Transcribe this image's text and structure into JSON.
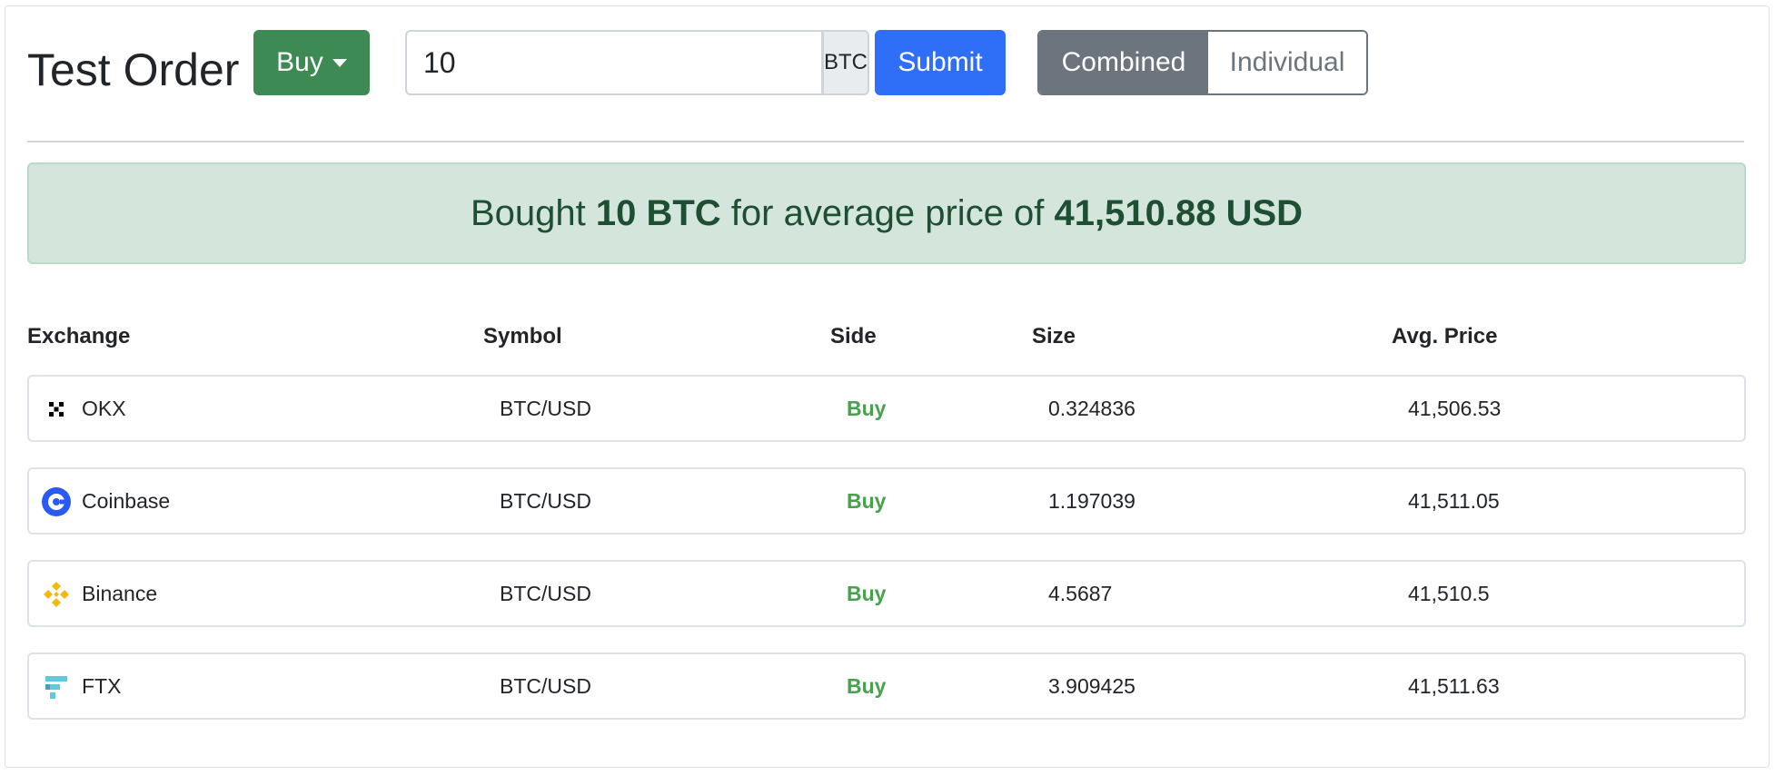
{
  "header": {
    "title": "Test Order",
    "side_dropdown_label": "Buy",
    "quantity_value": "10",
    "quantity_unit": "BTC",
    "submit_label": "Submit",
    "view_toggle": {
      "combined_label": "Combined",
      "individual_label": "Individual",
      "selected": "Combined"
    }
  },
  "result": {
    "prefix": "Bought",
    "amount": "10 BTC",
    "middle": "for average price of",
    "avg_price": "41,510.88 USD"
  },
  "table": {
    "columns": [
      "Exchange",
      "Symbol",
      "Side",
      "Size",
      "Avg. Price"
    ],
    "rows": [
      {
        "exchange": "OKX",
        "icon": "okx-icon",
        "symbol": "BTC/USD",
        "side": "Buy",
        "size": "0.324836",
        "avg_price": "41,506.53"
      },
      {
        "exchange": "Coinbase",
        "icon": "coinbase-icon",
        "symbol": "BTC/USD",
        "side": "Buy",
        "size": "1.197039",
        "avg_price": "41,511.05"
      },
      {
        "exchange": "Binance",
        "icon": "binance-icon",
        "symbol": "BTC/USD",
        "side": "Buy",
        "size": "4.5687",
        "avg_price": "41,510.5"
      },
      {
        "exchange": "FTX",
        "icon": "ftx-icon",
        "symbol": "BTC/USD",
        "side": "Buy",
        "size": "3.909425",
        "avg_price": "41,511.63"
      }
    ]
  },
  "colors": {
    "buy_button": "#3e8a55",
    "submit_button": "#2f6ef6",
    "toggle_active": "#6c757d",
    "alert_bg": "#d4e6dc",
    "side_buy_text": "#4aa04f"
  }
}
